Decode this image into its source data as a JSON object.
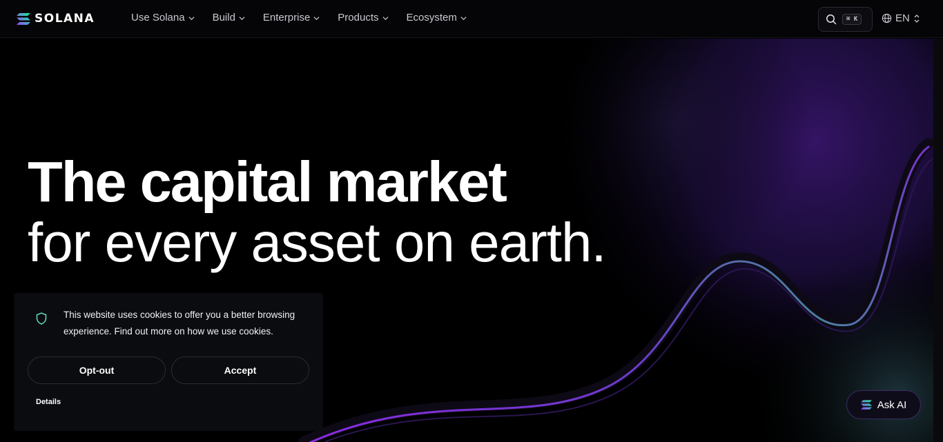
{
  "header": {
    "brand": "SOLANA",
    "nav": [
      {
        "label": "Use Solana"
      },
      {
        "label": "Build"
      },
      {
        "label": "Enterprise"
      },
      {
        "label": "Products"
      },
      {
        "label": "Ecosystem"
      }
    ],
    "search_shortcut": "⌘ K",
    "language": "EN"
  },
  "hero": {
    "title_line1": "The capital market",
    "title_line2": "for every asset on earth.",
    "subtitle_fragment": ","
  },
  "cookie_banner": {
    "message": "This website uses cookies to offer you a better browsing experience. Find out more on how we use cookies.",
    "optout_label": "Opt-out",
    "accept_label": "Accept",
    "details_label": "Details"
  },
  "ask_ai": {
    "label": "Ask AI"
  },
  "colors": {
    "accent_purple": "#9945FF",
    "accent_green": "#14F195",
    "background": "#000000"
  }
}
